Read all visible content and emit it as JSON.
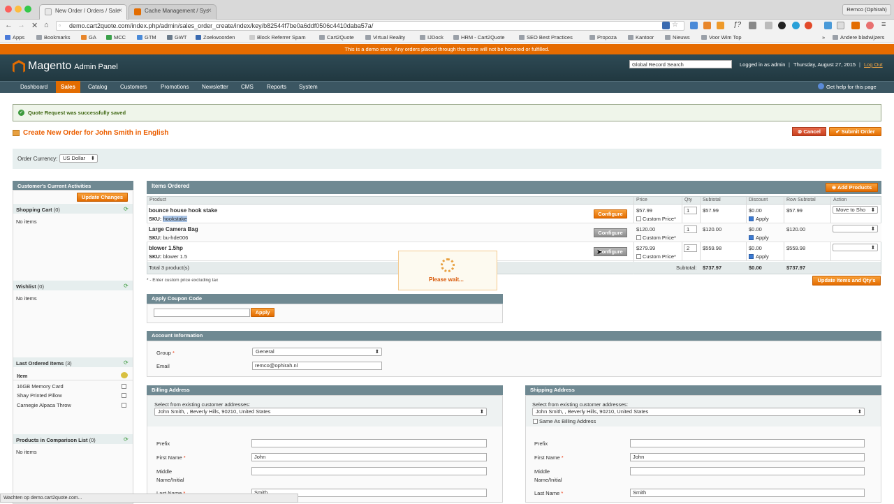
{
  "browser": {
    "tabs": [
      {
        "label": "New Order / Orders / Sale"
      },
      {
        "label": "Cache Management / Sys"
      }
    ],
    "url": "demo.cart2quote.com/index.php/admin/sales_order_create/index/key/b82544f7be0a6ddf0506c4410daba57a/",
    "profile": "Remco (Ophirah)",
    "bookmarks": [
      "Apps",
      "Bookmarks",
      "GA",
      "MCC",
      "GTM",
      "GWT",
      "Zoekwoorden",
      "Block Referrer Spam",
      "Cart2Quote",
      "Virtual Reality",
      "IJDock",
      "HRM - Cart2Quote",
      "SEO Best Practices",
      "Propoza",
      "Kantoor",
      "Nieuws",
      "Voor Wim Top"
    ],
    "other_bookmarks": "Andere bladwijzers",
    "status_bar": "Wachten op demo.cart2quote.com..."
  },
  "notice": "This is a demo store. Any orders placed through this store will not be honored or fulfilled.",
  "header": {
    "logo": "Magento",
    "logo_suffix": "Admin Panel",
    "search_placeholder": "Global Record Search",
    "logged_in": "Logged in as admin",
    "date": "Thursday, August 27, 2015",
    "logout": "Log Out"
  },
  "nav": {
    "items": [
      "Dashboard",
      "Sales",
      "Catalog",
      "Customers",
      "Promotions",
      "Newsletter",
      "CMS",
      "Reports",
      "System"
    ],
    "active": "Sales",
    "help": "Get help for this page"
  },
  "success_message": "Quote Request was successfully saved",
  "page_title": "Create New Order for John Smith in English",
  "buttons": {
    "cancel": "Cancel",
    "submit": "Submit Order",
    "update_changes": "Update Changes",
    "add_products": "Add Products",
    "update_items": "Update Items and Qty's",
    "apply": "Apply",
    "configure": "Configure"
  },
  "currency": {
    "label": "Order Currency:",
    "value": "US Dollar"
  },
  "sidebar": {
    "title": "Customer's Current Activities",
    "shopping_cart": {
      "title": "Shopping Cart",
      "count": "(0)",
      "empty": "No items"
    },
    "wishlist": {
      "title": "Wishlist",
      "count": "(0)",
      "empty": "No items"
    },
    "last_ordered": {
      "title": "Last Ordered Items",
      "count": "(3)",
      "col": "Item",
      "items": [
        "16GB Memory Card",
        "Shay Printed Pillow",
        "Carnegie Alpaca Throw"
      ]
    },
    "comparison": {
      "title": "Products in Comparison List",
      "count": "(0)",
      "empty": "No items"
    }
  },
  "items_ordered": {
    "title": "Items Ordered",
    "columns": [
      "Product",
      "Price",
      "Qty",
      "Subtotal",
      "Discount",
      "Row Subtotal",
      "Action"
    ],
    "sku_label": "SKU:",
    "custom_price": "Custom Price*",
    "apply_label": "Apply",
    "rows": [
      {
        "name": "bounce house hook stake",
        "sku": "hookstake",
        "price": "$57.99",
        "qty": "1",
        "subtotal": "$57.99",
        "discount": "$0.00",
        "row_subtotal": "$57.99",
        "action": "Move to Sho"
      },
      {
        "name": "Large Camera Bag",
        "sku": "bu-hde006",
        "price": "$120.00",
        "qty": "1",
        "subtotal": "$120.00",
        "discount": "$0.00",
        "row_subtotal": "$120.00",
        "action": ""
      },
      {
        "name": "blower 1.5hp",
        "sku": "blower 1.5",
        "price": "$279.99",
        "qty": "2",
        "subtotal": "$559.98",
        "discount": "$0.00",
        "row_subtotal": "$559.98",
        "action": ""
      }
    ],
    "total_products": "Total 3 product(s)",
    "subtotal_label": "Subtotal:",
    "subtotal": "$737.97",
    "discount_total": "$0.00",
    "row_subtotal_total": "$737.97",
    "note": "* - Enter custom price excluding tax"
  },
  "please_wait": "Please wait...",
  "coupon": {
    "title": "Apply Coupon Code"
  },
  "account": {
    "title": "Account Information",
    "group_label": "Group",
    "group_value": "General",
    "email_label": "Email",
    "email_value": "remco@ophirah.nl"
  },
  "billing": {
    "title": "Billing Address",
    "select_label": "Select from existing customer addresses:",
    "select_value": "John Smith, , Beverly Hills, 90210, United States",
    "prefix": "Prefix",
    "first_name": "First Name",
    "first_value": "John",
    "middle": "Middle",
    "middle2": "Name/Initial",
    "last_name": "Last Name",
    "last_value": "Smith"
  },
  "shipping": {
    "title": "Shipping Address",
    "select_label": "Select from existing customer addresses:",
    "select_value": "John Smith, , Beverly Hills, 90210, United States",
    "same_as": "Same As Billing Address",
    "prefix": "Prefix",
    "first_name": "First Name",
    "first_value": "John",
    "middle": "Middle",
    "middle2": "Name/Initial",
    "last_name": "Last Name",
    "last_value": "Smith"
  },
  "colors": {
    "accent": "#e36c00",
    "header": "#2e4a55",
    "section": "#6f8992"
  }
}
